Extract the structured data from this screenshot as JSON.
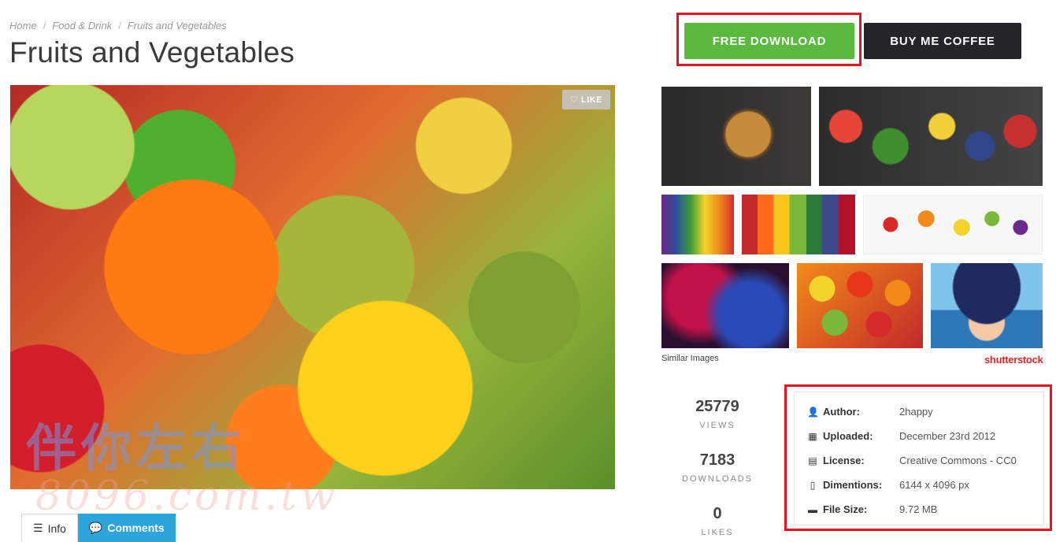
{
  "breadcrumb": [
    "Home",
    "Food & Drink",
    "Fruits and Vegetables"
  ],
  "page_title": "Fruits and Vegetables",
  "buttons": {
    "download": "FREE DOWNLOAD",
    "coffee": "BUY ME COFFEE"
  },
  "image": {
    "like": "LIKE",
    "watermark": "伴你左右",
    "watermark_url": "8096.com.tw"
  },
  "tabs": {
    "info": "Info",
    "comments": "Comments"
  },
  "similar": {
    "label": "Similar Images",
    "brand": "shutterstock"
  },
  "stats": [
    {
      "value": "25779",
      "label": "VIEWS"
    },
    {
      "value": "7183",
      "label": "DOWNLOADS"
    },
    {
      "value": "0",
      "label": "LIKES"
    }
  ],
  "info": {
    "author": {
      "key": "Author:",
      "value": "2happy"
    },
    "uploaded": {
      "key": "Uploaded:",
      "value": "December 23rd 2012"
    },
    "license": {
      "key": "License:",
      "value": "Creative Commons - CC0"
    },
    "dimensions": {
      "key": "Dimentions:",
      "value": "6144 x 4096 px"
    },
    "filesize": {
      "key": "File Size:",
      "value": "9.72 MB"
    }
  },
  "colors": {
    "download": "#5bb940",
    "coffee": "#23252b",
    "highlight": "#e8141b",
    "comments_tab": "#2ca5dc"
  }
}
